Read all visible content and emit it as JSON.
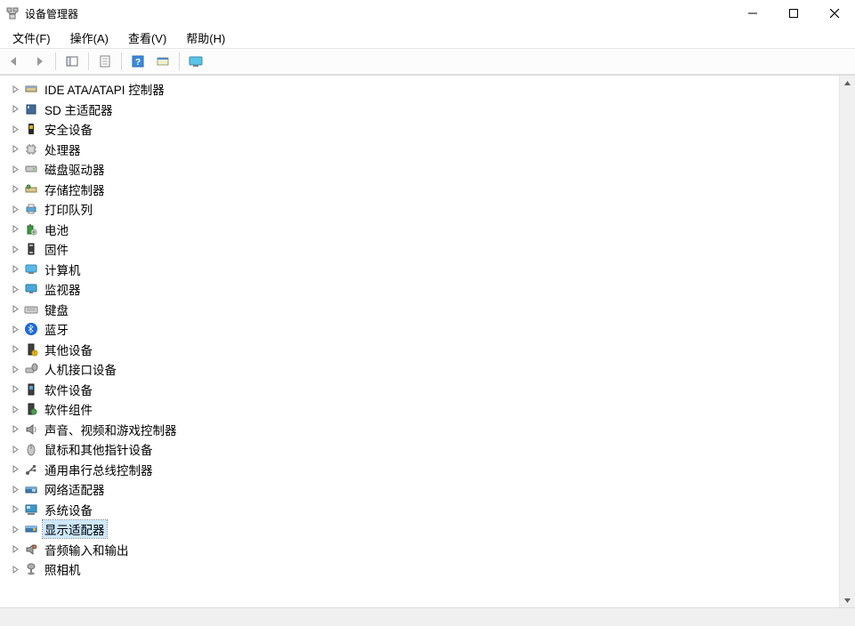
{
  "window": {
    "title": "设备管理器"
  },
  "menu": {
    "file": "文件(F)",
    "action": "操作(A)",
    "view": "查看(V)",
    "help": "帮助(H)"
  },
  "tree": {
    "items": [
      {
        "label": "IDE ATA/ATAPI 控制器",
        "icon": "ide-controller",
        "hasChildren": true
      },
      {
        "label": "SD 主适配器",
        "icon": "sd-adapter",
        "hasChildren": true
      },
      {
        "label": "安全设备",
        "icon": "security-device",
        "hasChildren": true
      },
      {
        "label": "处理器",
        "icon": "processor",
        "hasChildren": true
      },
      {
        "label": "磁盘驱动器",
        "icon": "disk-drive",
        "hasChildren": true
      },
      {
        "label": "存储控制器",
        "icon": "storage-controller",
        "hasChildren": true
      },
      {
        "label": "打印队列",
        "icon": "print-queue",
        "hasChildren": true
      },
      {
        "label": "电池",
        "icon": "battery",
        "hasChildren": true
      },
      {
        "label": "固件",
        "icon": "firmware",
        "hasChildren": true
      },
      {
        "label": "计算机",
        "icon": "computer",
        "hasChildren": true
      },
      {
        "label": "监视器",
        "icon": "monitor",
        "hasChildren": true
      },
      {
        "label": "键盘",
        "icon": "keyboard",
        "hasChildren": true
      },
      {
        "label": "蓝牙",
        "icon": "bluetooth",
        "hasChildren": true
      },
      {
        "label": "其他设备",
        "icon": "other-device",
        "hasChildren": true
      },
      {
        "label": "人机接口设备",
        "icon": "hid-device",
        "hasChildren": true
      },
      {
        "label": "软件设备",
        "icon": "software-device",
        "hasChildren": true
      },
      {
        "label": "软件组件",
        "icon": "software-component",
        "hasChildren": true
      },
      {
        "label": "声音、视频和游戏控制器",
        "icon": "sound-video-game",
        "hasChildren": true
      },
      {
        "label": "鼠标和其他指针设备",
        "icon": "mouse",
        "hasChildren": true
      },
      {
        "label": "通用串行总线控制器",
        "icon": "usb-controller",
        "hasChildren": true
      },
      {
        "label": "网络适配器",
        "icon": "network-adapter",
        "hasChildren": true
      },
      {
        "label": "系统设备",
        "icon": "system-device",
        "hasChildren": true
      },
      {
        "label": "显示适配器",
        "icon": "display-adapter",
        "hasChildren": true,
        "selected": true
      },
      {
        "label": "音频输入和输出",
        "icon": "audio-io",
        "hasChildren": true
      },
      {
        "label": "照相机",
        "icon": "camera",
        "hasChildren": true
      }
    ]
  }
}
